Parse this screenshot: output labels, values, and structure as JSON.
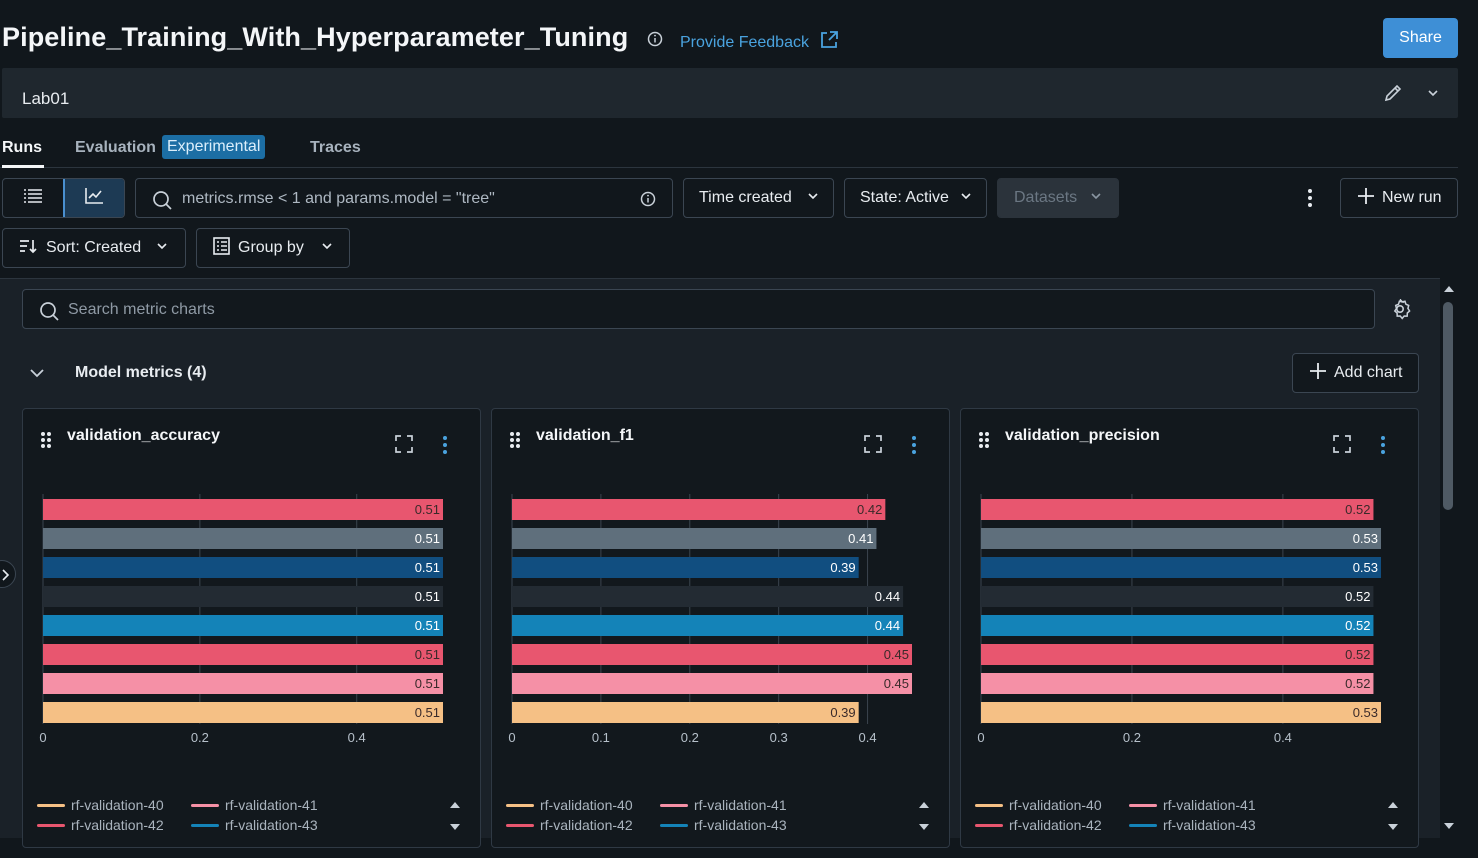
{
  "header": {
    "title": "Pipeline_Training_With_Hyperparameter_Tuning",
    "feedback_label": "Provide Feedback",
    "share_label": "Share"
  },
  "description": {
    "text": "Lab01"
  },
  "tabs": {
    "runs": "Runs",
    "evaluation": "Evaluation",
    "experimental_badge": "Experimental",
    "traces": "Traces"
  },
  "toolbar": {
    "search_value": "metrics.rmse < 1 and params.model = \"tree\"",
    "time_created": "Time created",
    "state": "State: Active",
    "datasets": "Datasets",
    "new_run": "New run",
    "sort": "Sort: Created",
    "group_by": "Group by"
  },
  "charts_panel": {
    "search_placeholder": "Search metric charts",
    "section_title": "Model metrics (4)",
    "add_chart": "Add chart"
  },
  "legend": [
    {
      "name": "rf-validation-40",
      "color": "#f5c085"
    },
    {
      "name": "rf-validation-41",
      "color": "#f590a6"
    },
    {
      "name": "rf-validation-42",
      "color": "#e8566f"
    },
    {
      "name": "rf-validation-43",
      "color": "#1483b8"
    }
  ],
  "chart_data": [
    {
      "type": "bar",
      "orientation": "horizontal",
      "title": "validation_accuracy",
      "xlim": [
        0,
        0.51
      ],
      "xticks": [
        "0",
        "0.2",
        "0.4"
      ],
      "values": [
        0.51,
        0.51,
        0.51,
        0.51,
        0.51,
        0.51,
        0.51,
        0.51
      ],
      "labels": [
        "0.51",
        "0.51",
        "0.51",
        "0.51",
        "0.51",
        "0.51",
        "0.51",
        "0.51"
      ],
      "colors": [
        "#e8566f",
        "#5f6f7c",
        "#114e80",
        "#232b33",
        "#1483b8",
        "#e8566f",
        "#f590a6",
        "#f5c085"
      ]
    },
    {
      "type": "bar",
      "orientation": "horizontal",
      "title": "validation_f1",
      "xlim": [
        0,
        0.45
      ],
      "xticks": [
        "0",
        "0.1",
        "0.2",
        "0.3",
        "0.4"
      ],
      "values": [
        0.42,
        0.41,
        0.39,
        0.44,
        0.44,
        0.45,
        0.45,
        0.39
      ],
      "labels": [
        "0.42",
        "0.41",
        "0.39",
        "0.44",
        "0.44",
        "0.45",
        "0.45",
        "0.39"
      ],
      "colors": [
        "#e8566f",
        "#5f6f7c",
        "#114e80",
        "#232b33",
        "#1483b8",
        "#e8566f",
        "#f590a6",
        "#f5c085"
      ]
    },
    {
      "type": "bar",
      "orientation": "horizontal",
      "title": "validation_precision",
      "xlim": [
        0,
        0.53
      ],
      "xticks": [
        "0",
        "0.2",
        "0.4"
      ],
      "values": [
        0.52,
        0.53,
        0.53,
        0.52,
        0.52,
        0.52,
        0.52,
        0.53
      ],
      "labels": [
        "0.52",
        "0.53",
        "0.53",
        "0.52",
        "0.52",
        "0.52",
        "0.52",
        "0.53"
      ],
      "colors": [
        "#e8566f",
        "#5f6f7c",
        "#114e80",
        "#232b33",
        "#1483b8",
        "#e8566f",
        "#f590a6",
        "#f5c085"
      ]
    }
  ]
}
